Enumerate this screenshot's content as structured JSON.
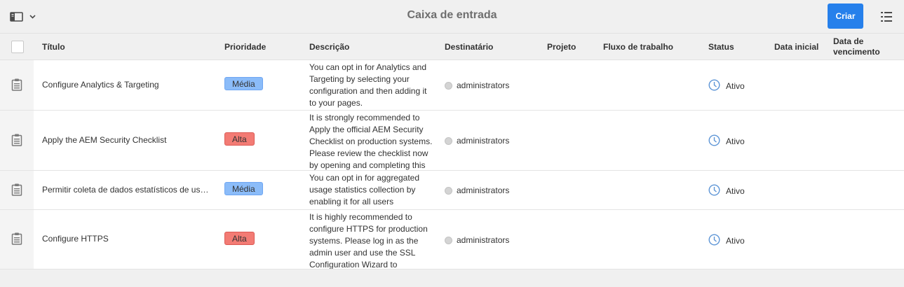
{
  "header": {
    "title": "Caixa de entrada",
    "create_label": "Criar"
  },
  "columns": {
    "title": "Título",
    "priority": "Prioridade",
    "description": "Descrição",
    "assignee": "Destinatário",
    "project": "Projeto",
    "workflow": "Fluxo de trabalho",
    "status": "Status",
    "start_date": "Data inicial",
    "due_date_line1": "Data de",
    "due_date_line2": "vencimento"
  },
  "rows": [
    {
      "title": "Configure Analytics & Targeting",
      "priority": "Média",
      "priority_level": "medium",
      "description": [
        "You can opt in for Analytics and",
        "Targeting by selecting your",
        "configuration and then adding it",
        "to your pages."
      ],
      "assignee": "administrators",
      "status": "Ativo"
    },
    {
      "title": "Apply the AEM Security Checklist",
      "priority": "Alta",
      "priority_level": "high",
      "description": [
        "It is strongly recommended to",
        "Apply the official AEM Security",
        "Checklist on production systems.",
        "Please review the checklist now",
        "by opening and completing this"
      ],
      "assignee": "administrators",
      "status": "Ativo"
    },
    {
      "title": "Permitir coleta de dados estatísticos de uso...",
      "priority": "Média",
      "priority_level": "medium",
      "description": [
        "You can opt in for aggregated",
        "usage statistics collection by",
        "enabling it for all users"
      ],
      "assignee": "administrators",
      "status": "Ativo"
    },
    {
      "title": "Configure HTTPS",
      "priority": "Alta",
      "priority_level": "high",
      "description": [
        "It is highly recommended to",
        "configure HTTPS for production",
        "systems. Please log in as the",
        "admin user and use the SSL",
        "Configuration Wizard to"
      ],
      "assignee": "administrators",
      "status": "Ativo"
    }
  ],
  "icons": {
    "rail_toggle": "sidebar-icon",
    "dropdown": "chevron-down-icon",
    "view_switcher": "list-view-icon",
    "task": "clipboard-icon",
    "assignee": "user-dot-icon",
    "status": "clock-icon"
  },
  "colors": {
    "primary": "#2680eb",
    "priority_medium": "#8bbcf9",
    "priority_high": "#f37b74",
    "status_icon": "#5d95d6"
  }
}
